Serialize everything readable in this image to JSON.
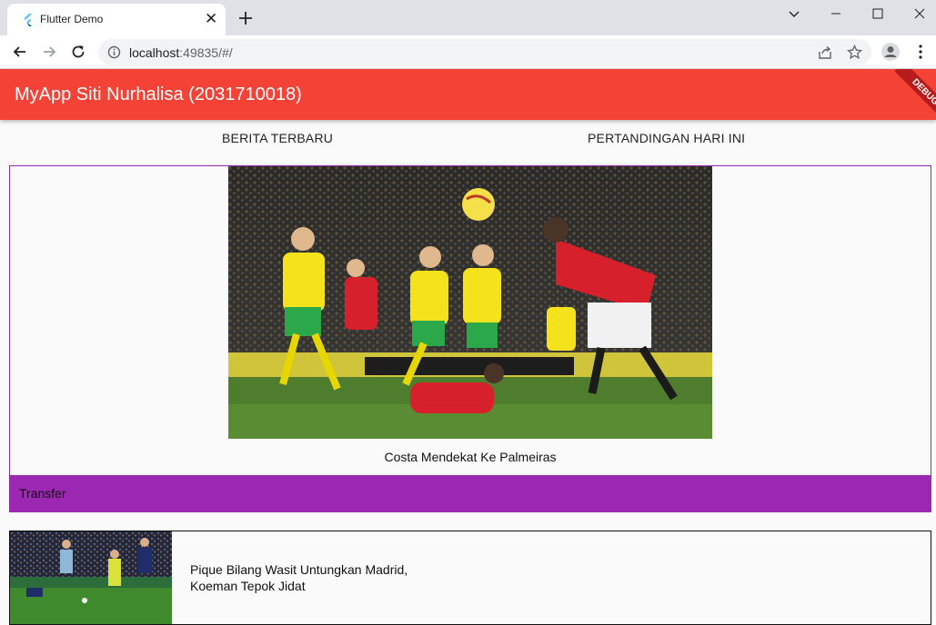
{
  "browser": {
    "tab_title": "Flutter Demo",
    "tab_close": "✕",
    "new_tab": "+",
    "url_host": "localhost",
    "url_rest": ":49835/#/"
  },
  "app": {
    "title": "MyApp Siti Nurhalisa (2031710018)",
    "debug_banner": "DEBUG",
    "accent": "#f44336",
    "purple": "#9c27b0"
  },
  "tabs": [
    {
      "label": "BERITA TERBARU"
    },
    {
      "label": "PERTANDINGAN HARI INI"
    }
  ],
  "featured": {
    "caption": "Costa Mendekat Ke Palmeiras",
    "category": "Transfer"
  },
  "news": [
    {
      "title": "Pique Bilang Wasit Untungkan Madrid, Koeman Tepok Jidat"
    }
  ]
}
